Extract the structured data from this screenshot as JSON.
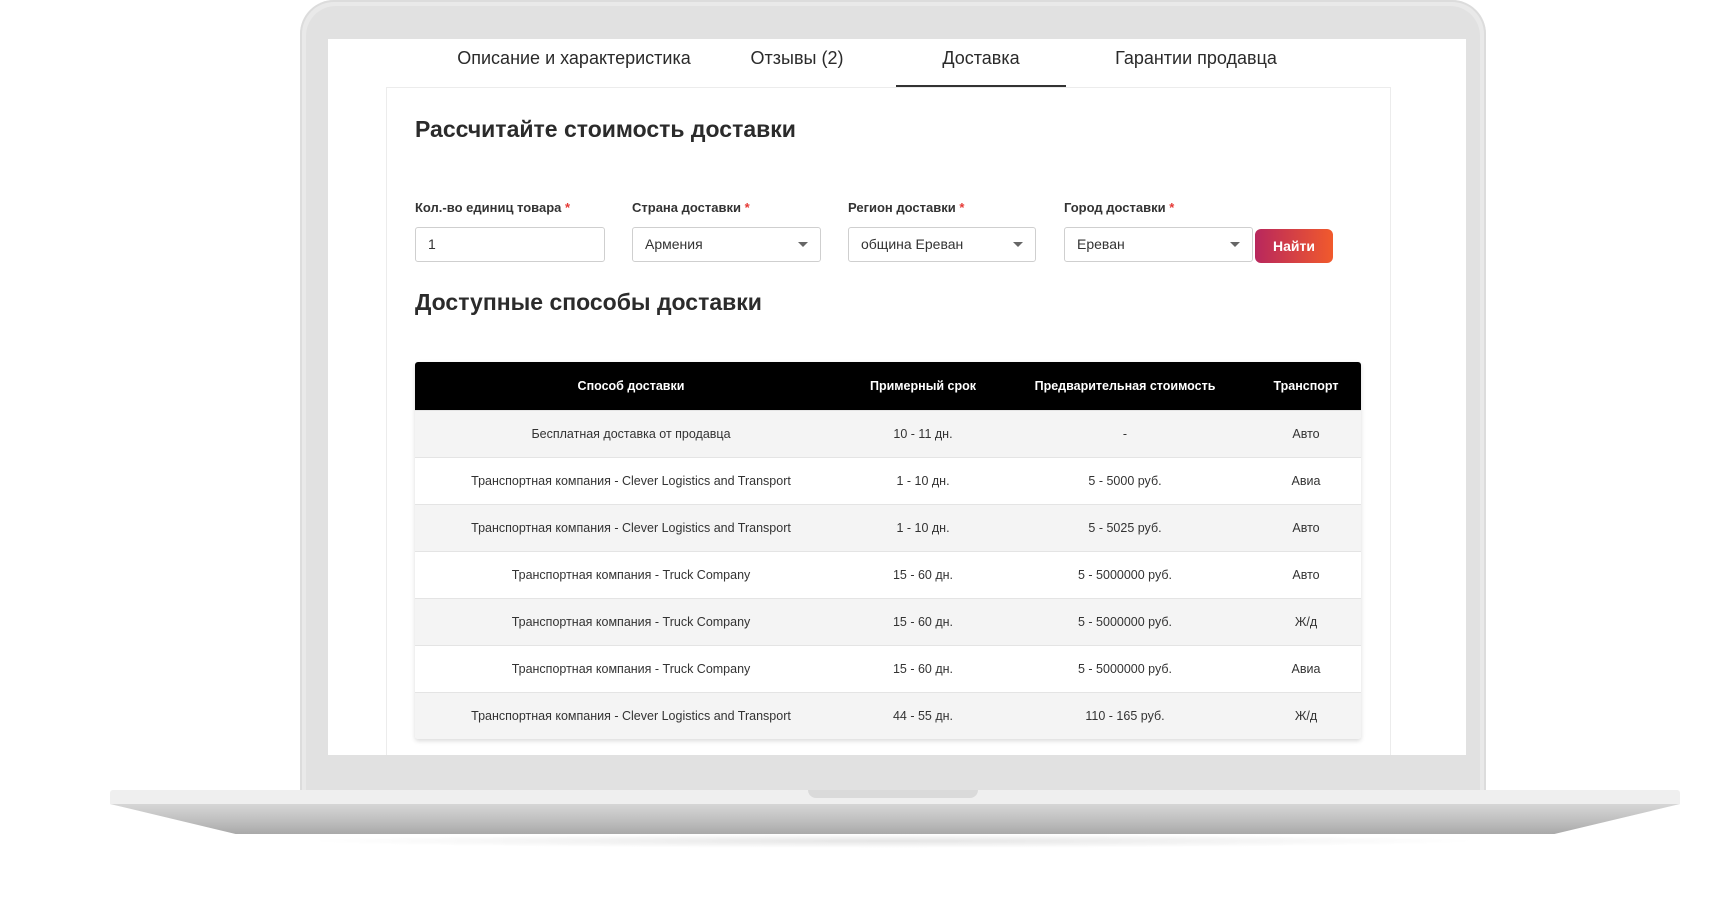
{
  "tabs": [
    {
      "label": "Описание и характеристика"
    },
    {
      "label": "Отзывы (2)"
    },
    {
      "label": "Доставка"
    },
    {
      "label": "Гарантии продавца"
    }
  ],
  "calculator": {
    "title": "Рассчитайте стоимость доставки",
    "required_mark": "*",
    "quantity": {
      "label": "Кол.-во единиц товара",
      "value": "1"
    },
    "country": {
      "label": "Страна доставки",
      "value": "Армения"
    },
    "region": {
      "label": "Регион доставки",
      "value": "община Ереван"
    },
    "city": {
      "label": "Город доставки",
      "value": "Ереван"
    },
    "find_label": "Найти"
  },
  "methods": {
    "title": "Доступные способы доставки",
    "columns": [
      "Способ доставки",
      "Примерный срок",
      "Предварительная стоимость",
      "Транспорт"
    ],
    "rows": [
      [
        "Бесплатная доставка от продавца",
        "10 - 11 дн.",
        "-",
        "Авто"
      ],
      [
        "Транспортная компания - Clever Logistics and Transport",
        "1 - 10 дн.",
        "5 - 5000 руб.",
        "Авиа"
      ],
      [
        "Транспортная компания - Clever Logistics and Transport",
        "1 - 10 дн.",
        "5 - 5025 руб.",
        "Авто"
      ],
      [
        "Транспортная компания - Truck Company",
        "15 - 60 дн.",
        "5 - 5000000 руб.",
        "Авто"
      ],
      [
        "Транспортная компания - Truck Company",
        "15 - 60 дн.",
        "5 - 5000000 руб.",
        "Ж/д"
      ],
      [
        "Транспортная компания - Truck Company",
        "15 - 60 дн.",
        "5 - 5000000 руб.",
        "Авиа"
      ],
      [
        "Транспортная компания - Clever Logistics and Transport",
        "44 - 55 дн.",
        "110 - 165 руб.",
        "Ж/д"
      ]
    ]
  }
}
